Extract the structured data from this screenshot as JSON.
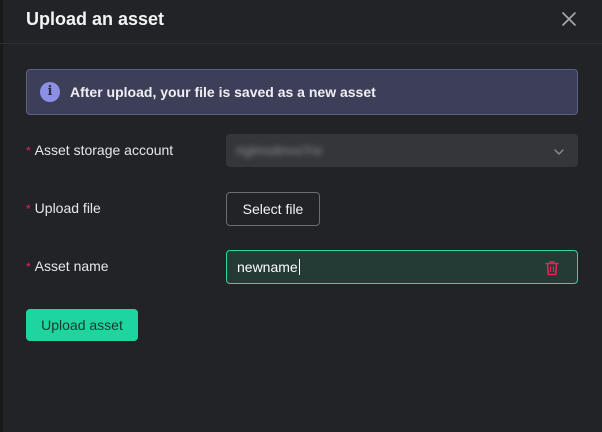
{
  "dialog": {
    "title": "Upload an asset"
  },
  "info": {
    "icon": "info-icon",
    "text": "After upload, your file is saved as a new asset"
  },
  "form": {
    "storage_account": {
      "required_marker": "*",
      "label": "Asset storage account",
      "value": "rtglmsdmvoTre"
    },
    "upload_file": {
      "required_marker": "*",
      "label": "Upload file",
      "button_label": "Select file"
    },
    "asset_name": {
      "required_marker": "*",
      "label": "Asset name",
      "value": "newname"
    }
  },
  "actions": {
    "upload_label": "Upload asset"
  },
  "colors": {
    "background": "#222326",
    "accent": "#1ed5a0",
    "info_bg": "#3d3f58",
    "required": "#e2245a",
    "delete": "#e2245a"
  }
}
